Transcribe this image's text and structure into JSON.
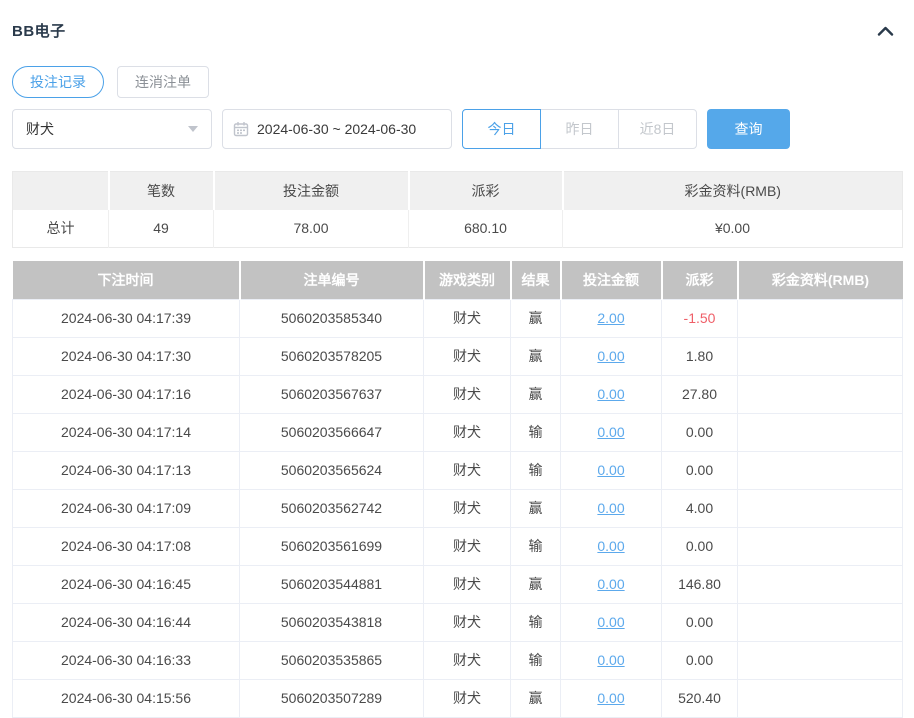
{
  "header": {
    "title": "BB电子"
  },
  "tabs": [
    {
      "label": "投注记录",
      "active": true
    },
    {
      "label": "连消注单",
      "active": false
    }
  ],
  "filters": {
    "game_select": {
      "value": "财犬"
    },
    "date_range": {
      "value": "2024-06-30 ~ 2024-06-30"
    },
    "quick_buttons": [
      {
        "label": "今日",
        "active": true
      },
      {
        "label": "昨日",
        "active": false
      },
      {
        "label": "近8日",
        "active": false
      }
    ],
    "query_label": "查询"
  },
  "summary": {
    "columns": [
      "",
      "笔数",
      "投注金额",
      "派彩",
      "彩金资料(RMB)"
    ],
    "row": {
      "label": "总计",
      "count": "49",
      "bet_amount": "78.00",
      "payout": "680.10",
      "bonus": "¥0.00"
    }
  },
  "records": {
    "columns": [
      "下注时间",
      "注单编号",
      "游戏类别",
      "结果",
      "投注金额",
      "派彩",
      "彩金资料(RMB)"
    ],
    "rows": [
      {
        "time": "2024-06-30 04:17:39",
        "order_id": "5060203585340",
        "game": "财犬",
        "result": "赢",
        "bet_amount": "2.00",
        "payout": "-1.50",
        "bonus": ""
      },
      {
        "time": "2024-06-30 04:17:30",
        "order_id": "5060203578205",
        "game": "财犬",
        "result": "赢",
        "bet_amount": "0.00",
        "payout": "1.80",
        "bonus": ""
      },
      {
        "time": "2024-06-30 04:17:16",
        "order_id": "5060203567637",
        "game": "财犬",
        "result": "赢",
        "bet_amount": "0.00",
        "payout": "27.80",
        "bonus": ""
      },
      {
        "time": "2024-06-30 04:17:14",
        "order_id": "5060203566647",
        "game": "财犬",
        "result": "输",
        "bet_amount": "0.00",
        "payout": "0.00",
        "bonus": ""
      },
      {
        "time": "2024-06-30 04:17:13",
        "order_id": "5060203565624",
        "game": "财犬",
        "result": "输",
        "bet_amount": "0.00",
        "payout": "0.00",
        "bonus": ""
      },
      {
        "time": "2024-06-30 04:17:09",
        "order_id": "5060203562742",
        "game": "财犬",
        "result": "赢",
        "bet_amount": "0.00",
        "payout": "4.00",
        "bonus": ""
      },
      {
        "time": "2024-06-30 04:17:08",
        "order_id": "5060203561699",
        "game": "财犬",
        "result": "输",
        "bet_amount": "0.00",
        "payout": "0.00",
        "bonus": ""
      },
      {
        "time": "2024-06-30 04:16:45",
        "order_id": "5060203544881",
        "game": "财犬",
        "result": "赢",
        "bet_amount": "0.00",
        "payout": "146.80",
        "bonus": ""
      },
      {
        "time": "2024-06-30 04:16:44",
        "order_id": "5060203543818",
        "game": "财犬",
        "result": "输",
        "bet_amount": "0.00",
        "payout": "0.00",
        "bonus": ""
      },
      {
        "time": "2024-06-30 04:16:33",
        "order_id": "5060203535865",
        "game": "财犬",
        "result": "输",
        "bet_amount": "0.00",
        "payout": "0.00",
        "bonus": ""
      },
      {
        "time": "2024-06-30 04:15:56",
        "order_id": "5060203507289",
        "game": "财犬",
        "result": "赢",
        "bet_amount": "0.00",
        "payout": "520.40",
        "bonus": ""
      }
    ]
  },
  "colors": {
    "accent": "#4ba1e8",
    "link": "#5ca9ec",
    "negative": "#ef5f68",
    "records_header_bg": "#c2c2c2",
    "query_button_bg": "#55a8ea"
  }
}
